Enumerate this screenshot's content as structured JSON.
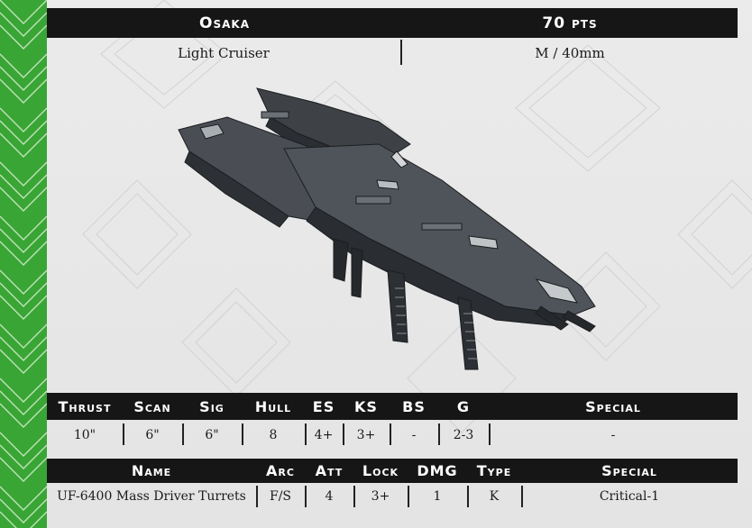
{
  "header": {
    "name": "Osaka",
    "points": "70 pts"
  },
  "subheader": {
    "class": "Light Cruiser",
    "size": "M / 40mm"
  },
  "ship_image": {
    "alt": "ship miniature render"
  },
  "stats": {
    "headers": [
      "Thrust",
      "Scan",
      "Sig",
      "Hull",
      "ES",
      "KS",
      "BS",
      "G",
      "Special"
    ],
    "values": [
      "10\"",
      "6\"",
      "6\"",
      "8",
      "4+",
      "3+",
      "-",
      "2-3",
      "-"
    ]
  },
  "weapons": {
    "headers": [
      "Name",
      "Arc",
      "Att",
      "Lock",
      "DMG",
      "Type",
      "Special"
    ],
    "rows": [
      [
        "UF-6400 Mass Driver Turrets",
        "F/S",
        "4",
        "3+",
        "1",
        "K",
        "Critical-1"
      ]
    ]
  },
  "colors": {
    "accent_green": "#39a535",
    "bar_black": "#161616",
    "background": "#e9e9e9"
  }
}
